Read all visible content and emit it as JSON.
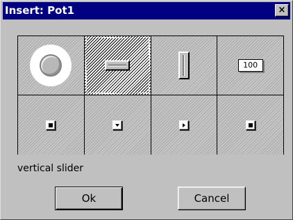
{
  "window": {
    "title": "Insert: Pot1",
    "close_label": "×"
  },
  "palette": {
    "selected_index": 1,
    "top_row": [
      {
        "icon": "knob-icon"
      },
      {
        "icon": "horizontal-slider-icon"
      },
      {
        "icon": "vertical-slider-icon"
      },
      {
        "icon": "number-box-icon",
        "text": "100"
      }
    ],
    "bottom_row": [
      {
        "icon": "small-square-icon"
      },
      {
        "icon": "small-down-arrow-icon"
      },
      {
        "icon": "small-right-arrow-icon"
      },
      {
        "icon": "small-square-icon"
      }
    ]
  },
  "status_text": "vertical slider",
  "buttons": {
    "ok": "Ok",
    "cancel": "Cancel"
  },
  "colors": {
    "titlebar": "#000080",
    "dialog_face": "#c0c0c0"
  }
}
